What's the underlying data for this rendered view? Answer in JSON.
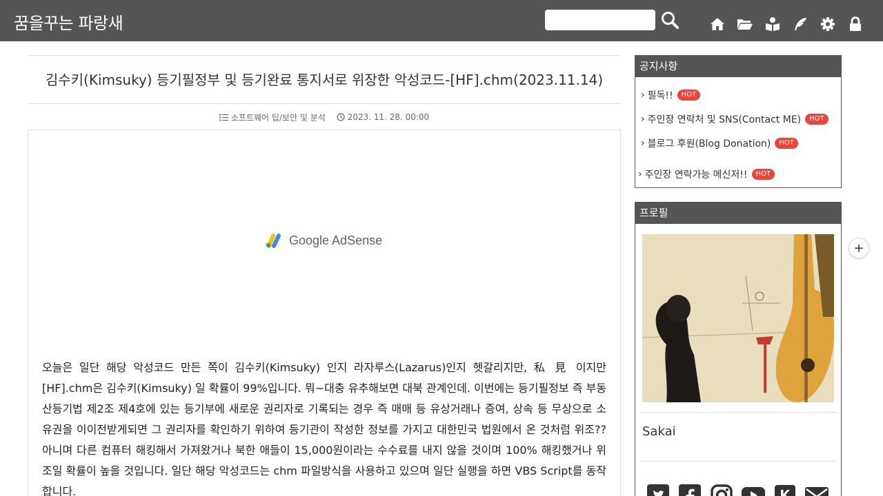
{
  "header": {
    "site_title": "꿈을꾸는 파랑새",
    "search_value": "",
    "icons": [
      "home-icon",
      "folder-icon",
      "guestbook-icon",
      "write-icon",
      "settings-icon",
      "lock-icon"
    ]
  },
  "post": {
    "title": "김수키(Kimsuky) 등기필정부 및 등기완료 통지서로 위장한 악성코드-[HF].chm(2023.11.14)",
    "category": "소프트웨어 팁/보안 및 분석",
    "date": "2023. 11. 28. 00:00",
    "ad_label": "Google AdSense",
    "body": "오늘은 일단 해당 악성코드 만든 쪽이 김수키(Kimsuky) 인지 라자루스(Lazarus)인지 헷갈리지만, 私 見 이지만 [HF].chm은 김수키(Kimsuky) 일 확률이 99%입니다. 뭐~대충 유추해보면 대북 관계인데. 이번에는 등기필정보 즉 부동산등기법 제2조 제4호에 있는 등기부에 새로운 권리자로 기록되는 경우 즉 매매 등 유상거래나 증여, 상속 등 무상으로 소유권을 이이전받게되면 그 권리자를 확인하기 위하여 등기관이 작성한 정보를 가지고 대한민국 법원에서 온 것처럼 위조?? 아니며 다른 컴퓨터 해킹해서 가져왔거나 북한 애들이 15,000원이라는 수수료를 내지 않을 것이며 100% 해킹했거나 위조일 확률이 높을 것입니다. 일단 해당 악성코드는 chm 파일방식을 사용하고 있으며 일단 실행을 하면 VBS Script를 동작합니다."
  },
  "sidebar": {
    "notice": {
      "title": "공지사항",
      "items": [
        {
          "label": "필독!!",
          "badge": "HOT"
        },
        {
          "label": "주인장 연락처 및 SNS(Contact ME)",
          "badge": "HOT"
        },
        {
          "label": "블로그 후원(Blog Donation)",
          "badge": "HOT"
        },
        {
          "label": "주인장 연락가능 메신저!!",
          "badge": "HOT"
        }
      ]
    },
    "profile": {
      "title": "프로필",
      "name": "Sakai",
      "social": [
        "twitter-icon",
        "facebook-icon",
        "instagram-icon",
        "youtube-icon",
        "kakao-icon",
        "mail-icon"
      ]
    }
  },
  "colors": {
    "header_bg": "#555555",
    "hot_badge": "#e8453c"
  }
}
